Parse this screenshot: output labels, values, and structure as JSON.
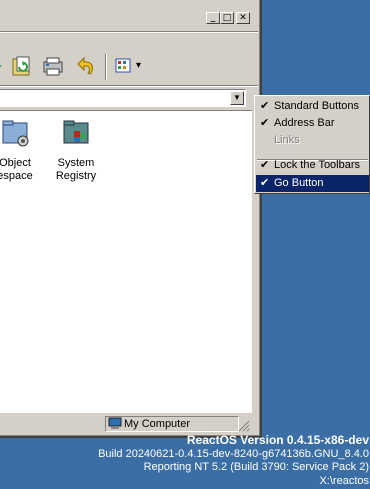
{
  "status_bar": {
    "location": "My Computer"
  },
  "items": [
    {
      "label_line1": "Object",
      "label_line2": "espace"
    },
    {
      "label_line1": "System",
      "label_line2": "Registry"
    }
  ],
  "menu": {
    "standard_buttons": "Standard Buttons",
    "address_bar": "Address Bar",
    "links": "Links",
    "lock_toolbars": "Lock the Toolbars",
    "go_button": "Go Button",
    "check": "✔"
  },
  "caption_buttons": {
    "minimize": "_",
    "maximize": "□",
    "close": "✕"
  },
  "address_dropdown_glyph": "▼",
  "toolbar_views_glyph": "▾",
  "desktop_version": {
    "line1": "ReactOS Version 0.4.15-x86-dev",
    "line2": "Build 20240621-0.4.15-dev-8240-g674136b.GNU_8.4.0",
    "line3": "Reporting NT 5.2 (Build 3790: Service Pack 2)",
    "line4": "X:\\reactos"
  },
  "colors": {
    "desktop": "#3a6ea5",
    "highlight": "#0a246a",
    "face": "#d4d0c8"
  }
}
